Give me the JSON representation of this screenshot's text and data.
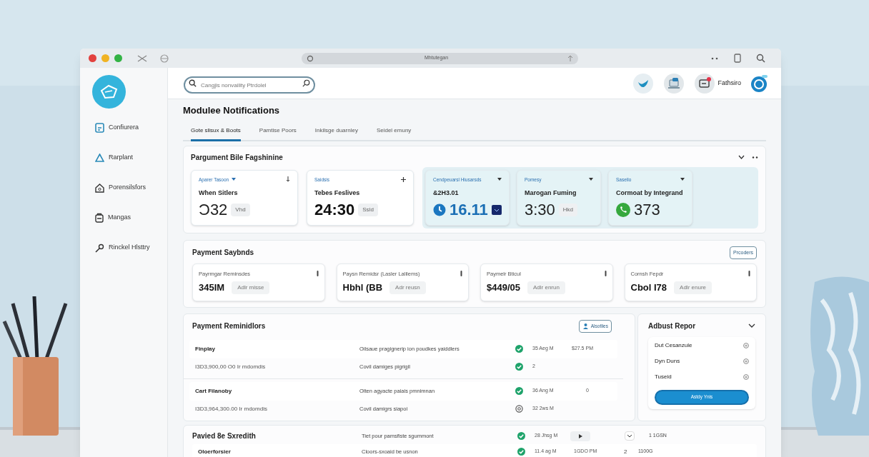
{
  "browser": {
    "address": "Mhtutegan"
  },
  "sidebar": {
    "items": [
      {
        "label": "Confiurera"
      },
      {
        "label": "Rarplant"
      },
      {
        "label": "Porensilsfors"
      },
      {
        "label": "Mangas"
      },
      {
        "label": "Rinckel Hlsttry"
      }
    ]
  },
  "header": {
    "search_placeholder": "Cangjis nonvaility Ptrdolel",
    "profile_label": "Fathsiro"
  },
  "page_title": "Modulee Notifications",
  "tabs": [
    {
      "label": "Gote slisux & Boots",
      "selected": true
    },
    {
      "label": "Pamtise Poors",
      "selected": false
    },
    {
      "label": "Inkilsge duarnley",
      "selected": false
    },
    {
      "label": "Seidel emuny",
      "selected": false
    }
  ],
  "summary": {
    "title": "Pargument Bile Fagshinine",
    "cards": [
      {
        "label": "Aparer Tasoon",
        "title": "When Sitlers",
        "value": "Ɔ32",
        "chip": "Vhd",
        "highlighted": false,
        "kind": "plain"
      },
      {
        "label": "Saidsis",
        "title": "Tebes Feslives",
        "value": "24:30",
        "chip": "Ssld",
        "highlighted": false,
        "kind": "plain"
      },
      {
        "label": "Cendpeuarsl Hiusarsds",
        "title": "&2H3.01",
        "value": "16.11",
        "highlighted": true,
        "kind": "clock"
      },
      {
        "label": "Pomesy",
        "title": "Marogan Fuming",
        "value": "3:30",
        "chip": "Hkd",
        "highlighted": true,
        "kind": "plain"
      },
      {
        "label": "Saseilo",
        "title": "Cormoat by Integrand",
        "value": "373",
        "highlighted": true,
        "kind": "phone"
      }
    ]
  },
  "symbols": {
    "title": "Payment Saybnds",
    "button": "Prcoders",
    "cards": [
      {
        "label": "Payrmgar Reminsdes",
        "value": "345IM",
        "chip": "Adlr misse"
      },
      {
        "label": "Paysn Remidsr (Lasler Lalilems)",
        "value": "Hbhl (BB",
        "chip": "Adr reusn"
      },
      {
        "label": "Paymelr Bticul",
        "value": "$449/05",
        "chip": "Adlr enrun"
      },
      {
        "label": "Cornsh Fepdr",
        "value": "Cbol I78",
        "chip": "Adlr enure"
      }
    ]
  },
  "reminders": {
    "title": "Payment Reminidlors",
    "button": "Alsotlies",
    "groups": [
      {
        "rows": [
          {
            "name": "Finplay",
            "description": "Oilsaue pragignerip ion poudkes yaiddlers",
            "kind": "done",
            "time": "35 Aeg M",
            "amount": "$27.5 PM"
          },
          {
            "name": "I3D3,900,00 O0 Ir mdomdis",
            "description": "Covil damiges pigrigil",
            "kind": "done",
            "time": "2"
          }
        ]
      },
      {
        "rows": [
          {
            "name": "Cart Filanoby",
            "description": "Olten agyacte paiais pmnimnan",
            "kind": "done",
            "time": "36 Ang M",
            "amount": "0"
          },
          {
            "name": "I3D3,964,300.00 Ir mdomdis",
            "description": "Covil damigrs siapoi",
            "kind": "pending",
            "time": "32 2ws M"
          }
        ]
      }
    ]
  },
  "adjust_panel": {
    "title": "Adbust Repor",
    "options": [
      {
        "label": "Dut Cesanzule"
      },
      {
        "label": "Dyn Duns"
      },
      {
        "label": "Tuseid"
      }
    ],
    "button": "Astdy Ynis"
  },
  "schedule": {
    "title": "Pavied 8e Sxredith",
    "description": "Tiet pour pamsfiste sgummont",
    "kind": "done",
    "time": "28 Jhsg M",
    "total": "1 1GSN",
    "row": {
      "name": "Oloerforsier",
      "description": "Cloors-sxoaid be usnon",
      "kind": "done",
      "time": "11.4 ag M",
      "amount": "1GDO PM",
      "count": "2",
      "total": "1100G"
    }
  }
}
